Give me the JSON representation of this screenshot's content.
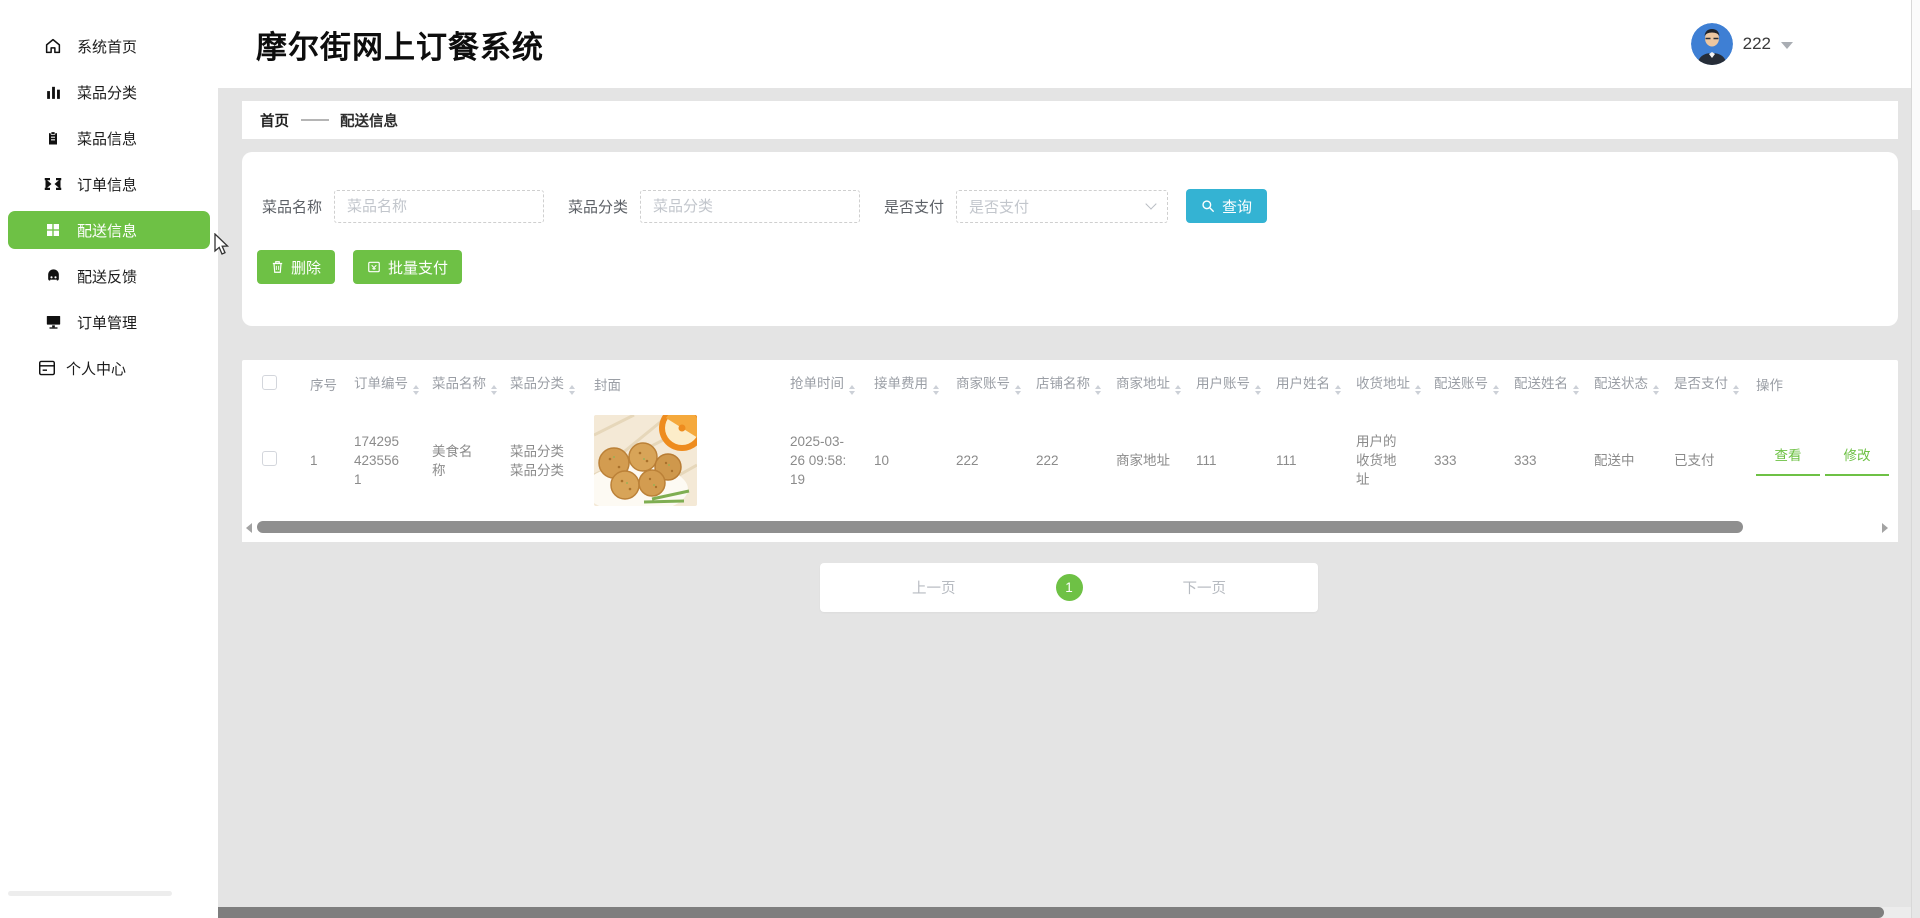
{
  "app": {
    "title": "摩尔街网上订餐系统"
  },
  "header": {
    "user_name": "222"
  },
  "sidebar": {
    "items": [
      {
        "label": "系统首页",
        "icon": "home-icon",
        "active": false
      },
      {
        "label": "菜品分类",
        "icon": "bar-chart-icon",
        "active": false
      },
      {
        "label": "菜品信息",
        "icon": "clipboard-icon",
        "active": false
      },
      {
        "label": "订单信息",
        "icon": "ticket-icon",
        "active": false
      },
      {
        "label": "配送信息",
        "icon": "grid-icon",
        "active": true
      },
      {
        "label": "配送反馈",
        "icon": "feedback-icon",
        "active": false
      },
      {
        "label": "订单管理",
        "icon": "monitor-icon",
        "active": false
      },
      {
        "label": "个人中心",
        "icon": "profile-icon",
        "active": false
      }
    ]
  },
  "breadcrumb": {
    "home": "首页",
    "separator": "——",
    "current": "配送信息"
  },
  "filters": {
    "name": {
      "label": "菜品名称",
      "placeholder": "菜品名称"
    },
    "category": {
      "label": "菜品分类",
      "placeholder": "菜品分类"
    },
    "paid": {
      "label": "是否支付",
      "placeholder": "是否支付"
    },
    "search_label": "查询"
  },
  "bulk": {
    "delete_label": "删除",
    "batch_pay_label": "批量支付"
  },
  "table": {
    "columns": [
      {
        "label": "序号",
        "sortable": false
      },
      {
        "label": "订单编号",
        "sortable": true
      },
      {
        "label": "菜品名称",
        "sortable": true
      },
      {
        "label": "菜品分类",
        "sortable": true
      },
      {
        "label": "封面",
        "sortable": false
      },
      {
        "label": "抢单时间",
        "sortable": true
      },
      {
        "label": "接单费用",
        "sortable": true
      },
      {
        "label": "商家账号",
        "sortable": true
      },
      {
        "label": "店铺名称",
        "sortable": true
      },
      {
        "label": "商家地址",
        "sortable": true
      },
      {
        "label": "用户账号",
        "sortable": true
      },
      {
        "label": "用户姓名",
        "sortable": true
      },
      {
        "label": "收货地址",
        "sortable": true
      },
      {
        "label": "配送账号",
        "sortable": true
      },
      {
        "label": "配送姓名",
        "sortable": true
      },
      {
        "label": "配送状态",
        "sortable": true
      },
      {
        "label": "是否支付",
        "sortable": true
      },
      {
        "label": "操作",
        "sortable": false
      }
    ],
    "row": {
      "index": "1",
      "order_no": "1742954235561",
      "dish_name": "美食名称",
      "dish_category": "菜品分类菜品分类",
      "cover": "dish-cover-image",
      "grab_time": "2025-03-26 09:58:19",
      "fee": "10",
      "merchant_account": "222",
      "shop_name": "222",
      "merchant_address": "商家地址",
      "user_account": "111",
      "user_name": "111",
      "delivery_address": "用户的收货地址",
      "courier_account": "333",
      "courier_name": "333",
      "delivery_status": "配送中",
      "paid_status": "已支付",
      "action_view": "查看",
      "action_edit": "修改"
    }
  },
  "pagination": {
    "prev": "上一页",
    "current": "1",
    "next": "下一页"
  },
  "colors": {
    "accent_green": "#6ec145",
    "accent_cyan": "#34b3d3",
    "page_bg": "#e4e4e4"
  }
}
